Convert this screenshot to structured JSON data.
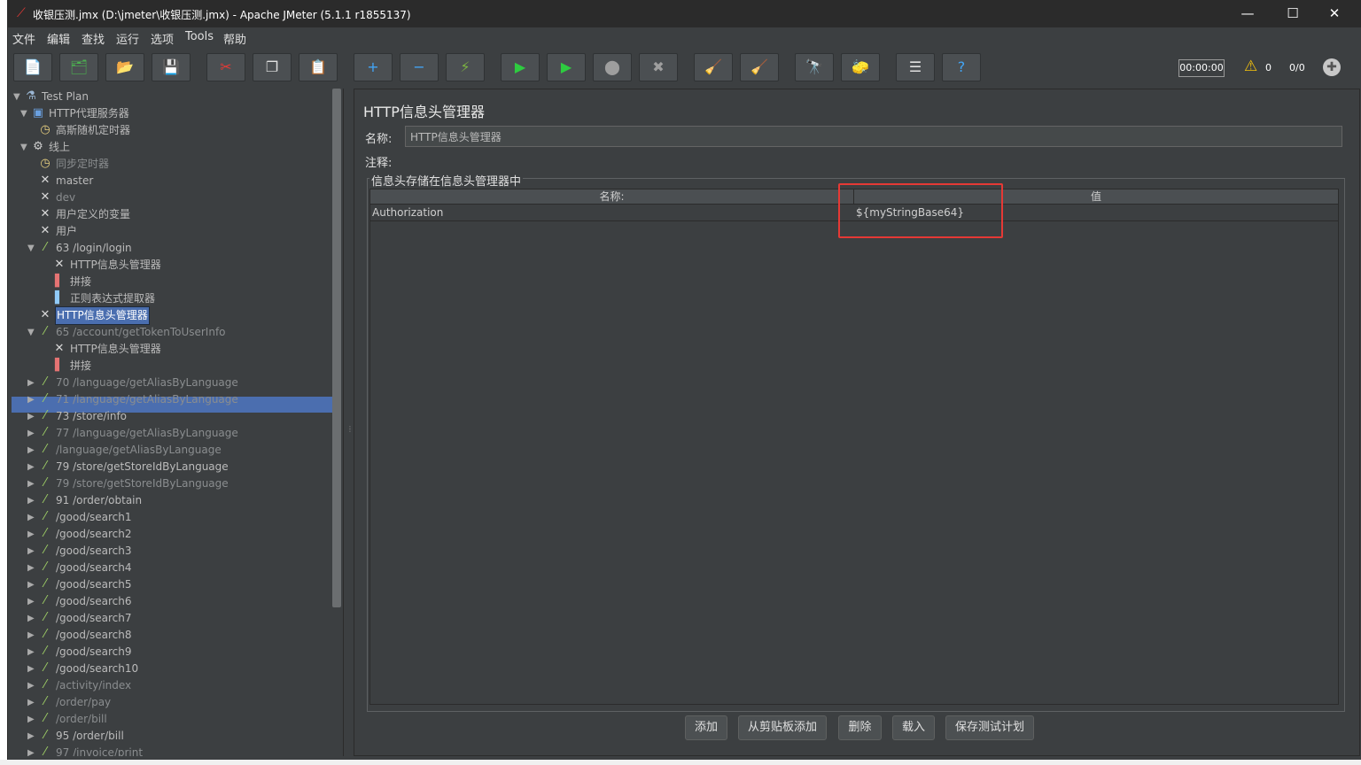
{
  "window": {
    "title": "收银压测.jmx (D:\\jmeter\\收银压测.jmx) - Apache JMeter (5.1.1 r1855137)",
    "min_glyph": "—",
    "max_glyph": "☐",
    "close_glyph": "✕"
  },
  "menu": [
    "文件",
    "编辑",
    "查找",
    "运行",
    "选项",
    "Tools",
    "帮助"
  ],
  "toolbar": {
    "buttons": [
      {
        "icon": "new-icon",
        "glyph": "📄"
      },
      {
        "icon": "templates-icon",
        "glyph": "🗂"
      },
      {
        "icon": "open-icon",
        "glyph": "📂"
      },
      {
        "icon": "save-icon",
        "glyph": "💾"
      },
      {
        "icon": "cut-icon",
        "glyph": "✂"
      },
      {
        "icon": "copy-icon",
        "glyph": "❐"
      },
      {
        "icon": "paste-icon",
        "glyph": "📋"
      },
      {
        "icon": "expand-icon",
        "glyph": "+"
      },
      {
        "icon": "collapse-icon",
        "glyph": "−"
      },
      {
        "icon": "toggle-icon",
        "glyph": "⚡"
      },
      {
        "icon": "start-icon",
        "glyph": "▶"
      },
      {
        "icon": "start-no-pause-icon",
        "glyph": "▶"
      },
      {
        "icon": "stop-icon",
        "glyph": "⬤"
      },
      {
        "icon": "shutdown-icon",
        "glyph": "✖"
      },
      {
        "icon": "clear-icon",
        "glyph": "🧹"
      },
      {
        "icon": "clear-all-icon",
        "glyph": "🧹"
      },
      {
        "icon": "search-icon",
        "glyph": "🔭"
      },
      {
        "icon": "reset-search-icon",
        "glyph": "🧽"
      },
      {
        "icon": "function-helper-icon",
        "glyph": "☰"
      },
      {
        "icon": "help-icon",
        "glyph": "?"
      }
    ],
    "timer": "00:00:00",
    "warning_count": "0",
    "thread_count": "0/0"
  },
  "tree": [
    {
      "label": "Test Plan",
      "level": 0,
      "toggle": "▼",
      "icon": "testplan-icon",
      "glyph": "⚗",
      "color": "#9bb7d4",
      "disabled": false
    },
    {
      "label": "HTTP代理服务器",
      "level": 1,
      "toggle": "▼",
      "icon": "proxy-icon",
      "glyph": "▣",
      "color": "#6aa0e0",
      "disabled": false
    },
    {
      "label": "高斯随机定时器",
      "level": 2,
      "toggle": "",
      "icon": "timer-icon",
      "glyph": "◷",
      "color": "#e8d080",
      "disabled": false
    },
    {
      "label": "线上",
      "level": 1,
      "toggle": "▼",
      "icon": "thread-group-icon",
      "glyph": "⚙",
      "color": "#cfcfcf",
      "disabled": false
    },
    {
      "label": "同步定时器",
      "level": 2,
      "toggle": "",
      "icon": "timer-icon",
      "glyph": "◷",
      "color": "#e8d080",
      "disabled": true
    },
    {
      "label": "master",
      "level": 2,
      "toggle": "",
      "icon": "config-icon",
      "glyph": "✕",
      "color": "#d8d8d8",
      "disabled": false
    },
    {
      "label": "dev",
      "level": 2,
      "toggle": "",
      "icon": "config-icon",
      "glyph": "✕",
      "color": "#d8d8d8",
      "disabled": true
    },
    {
      "label": "用户定义的变量",
      "level": 2,
      "toggle": "",
      "icon": "config-icon",
      "glyph": "✕",
      "color": "#d8d8d8",
      "disabled": false
    },
    {
      "label": "用户",
      "level": 2,
      "toggle": "",
      "icon": "config-icon",
      "glyph": "✕",
      "color": "#d8d8d8",
      "disabled": false
    },
    {
      "label": "63 /login/login",
      "level": 2,
      "toggle": "▼",
      "icon": "sampler-icon",
      "glyph": "⁄",
      "color": "#9ccc65",
      "disabled": false
    },
    {
      "label": "HTTP信息头管理器",
      "level": 3,
      "toggle": "",
      "icon": "config-icon",
      "glyph": "✕",
      "color": "#d8d8d8",
      "disabled": false
    },
    {
      "label": "拼接",
      "level": 3,
      "toggle": "",
      "icon": "preprocessor-icon",
      "glyph": "▌",
      "color": "#e57373",
      "disabled": false
    },
    {
      "label": "正则表达式提取器",
      "level": 3,
      "toggle": "",
      "icon": "postprocessor-icon",
      "glyph": "▌",
      "color": "#90caf9",
      "disabled": false
    },
    {
      "label": "HTTP信息头管理器",
      "level": 2,
      "toggle": "",
      "icon": "config-icon",
      "glyph": "✕",
      "color": "#d8d8d8",
      "disabled": false,
      "selected": true
    },
    {
      "label": "65 /account/getTokenToUserInfo",
      "level": 2,
      "toggle": "▼",
      "icon": "sampler-icon",
      "glyph": "⁄",
      "color": "#9ccc65",
      "disabled": true
    },
    {
      "label": "HTTP信息头管理器",
      "level": 3,
      "toggle": "",
      "icon": "config-icon",
      "glyph": "✕",
      "color": "#d8d8d8",
      "disabled": false
    },
    {
      "label": "拼接",
      "level": 3,
      "toggle": "",
      "icon": "preprocessor-icon",
      "glyph": "▌",
      "color": "#e57373",
      "disabled": false
    },
    {
      "label": "70 /language/getAliasByLanguage",
      "level": 2,
      "toggle": "▶",
      "icon": "sampler-icon",
      "glyph": "⁄",
      "color": "#9ccc65",
      "disabled": true
    },
    {
      "label": "71 /language/getAliasByLanguage",
      "level": 2,
      "toggle": "▶",
      "icon": "sampler-icon",
      "glyph": "⁄",
      "color": "#9ccc65",
      "disabled": true
    },
    {
      "label": "73 /store/info",
      "level": 2,
      "toggle": "▶",
      "icon": "sampler-icon",
      "glyph": "⁄",
      "color": "#9ccc65",
      "disabled": false
    },
    {
      "label": "77 /language/getAliasByLanguage",
      "level": 2,
      "toggle": "▶",
      "icon": "sampler-icon",
      "glyph": "⁄",
      "color": "#9ccc65",
      "disabled": true
    },
    {
      "label": "/language/getAliasByLanguage",
      "level": 2,
      "toggle": "▶",
      "icon": "sampler-icon",
      "glyph": "⁄",
      "color": "#9ccc65",
      "disabled": true
    },
    {
      "label": "79 /store/getStoreIdByLanguage",
      "level": 2,
      "toggle": "▶",
      "icon": "sampler-icon",
      "glyph": "⁄",
      "color": "#9ccc65",
      "disabled": false
    },
    {
      "label": "79 /store/getStoreIdByLanguage",
      "level": 2,
      "toggle": "▶",
      "icon": "sampler-icon",
      "glyph": "⁄",
      "color": "#9ccc65",
      "disabled": true
    },
    {
      "label": "91 /order/obtain",
      "level": 2,
      "toggle": "▶",
      "icon": "sampler-icon",
      "glyph": "⁄",
      "color": "#9ccc65",
      "disabled": false
    },
    {
      "label": " /good/search1",
      "level": 2,
      "toggle": "▶",
      "icon": "sampler-icon",
      "glyph": "⁄",
      "color": "#9ccc65",
      "disabled": false
    },
    {
      "label": " /good/search2",
      "level": 2,
      "toggle": "▶",
      "icon": "sampler-icon",
      "glyph": "⁄",
      "color": "#9ccc65",
      "disabled": false
    },
    {
      "label": " /good/search3",
      "level": 2,
      "toggle": "▶",
      "icon": "sampler-icon",
      "glyph": "⁄",
      "color": "#9ccc65",
      "disabled": false
    },
    {
      "label": " /good/search4",
      "level": 2,
      "toggle": "▶",
      "icon": "sampler-icon",
      "glyph": "⁄",
      "color": "#9ccc65",
      "disabled": false
    },
    {
      "label": " /good/search5",
      "level": 2,
      "toggle": "▶",
      "icon": "sampler-icon",
      "glyph": "⁄",
      "color": "#9ccc65",
      "disabled": false
    },
    {
      "label": " /good/search6",
      "level": 2,
      "toggle": "▶",
      "icon": "sampler-icon",
      "glyph": "⁄",
      "color": "#9ccc65",
      "disabled": false
    },
    {
      "label": " /good/search7",
      "level": 2,
      "toggle": "▶",
      "icon": "sampler-icon",
      "glyph": "⁄",
      "color": "#9ccc65",
      "disabled": false
    },
    {
      "label": " /good/search8",
      "level": 2,
      "toggle": "▶",
      "icon": "sampler-icon",
      "glyph": "⁄",
      "color": "#9ccc65",
      "disabled": false
    },
    {
      "label": " /good/search9",
      "level": 2,
      "toggle": "▶",
      "icon": "sampler-icon",
      "glyph": "⁄",
      "color": "#9ccc65",
      "disabled": false
    },
    {
      "label": " /good/search10",
      "level": 2,
      "toggle": "▶",
      "icon": "sampler-icon",
      "glyph": "⁄",
      "color": "#9ccc65",
      "disabled": false
    },
    {
      "label": "/activity/index",
      "level": 2,
      "toggle": "▶",
      "icon": "sampler-icon",
      "glyph": "⁄",
      "color": "#9ccc65",
      "disabled": true
    },
    {
      "label": "/order/pay",
      "level": 2,
      "toggle": "▶",
      "icon": "sampler-icon",
      "glyph": "⁄",
      "color": "#9ccc65",
      "disabled": true
    },
    {
      "label": "/order/bill",
      "level": 2,
      "toggle": "▶",
      "icon": "sampler-icon",
      "glyph": "⁄",
      "color": "#9ccc65",
      "disabled": true
    },
    {
      "label": "95 /order/bill",
      "level": 2,
      "toggle": "▶",
      "icon": "sampler-icon",
      "glyph": "⁄",
      "color": "#9ccc65",
      "disabled": false
    },
    {
      "label": "97 /invoice/print",
      "level": 2,
      "toggle": "▶",
      "icon": "sampler-icon",
      "glyph": "⁄",
      "color": "#9ccc65",
      "disabled": true
    }
  ],
  "panel": {
    "title": "HTTP信息头管理器",
    "name_label": "名称:",
    "name_value": "HTTP信息头管理器",
    "comment_label": "注释:",
    "group_title": "信息头存储在信息头管理器中",
    "columns": [
      "名称:",
      "值"
    ],
    "rows": [
      [
        "Authorization",
        "${myStringBase64}"
      ]
    ],
    "buttons": [
      "添加",
      "从剪贴板添加",
      "删除",
      "载入",
      "保存测试计划"
    ]
  }
}
